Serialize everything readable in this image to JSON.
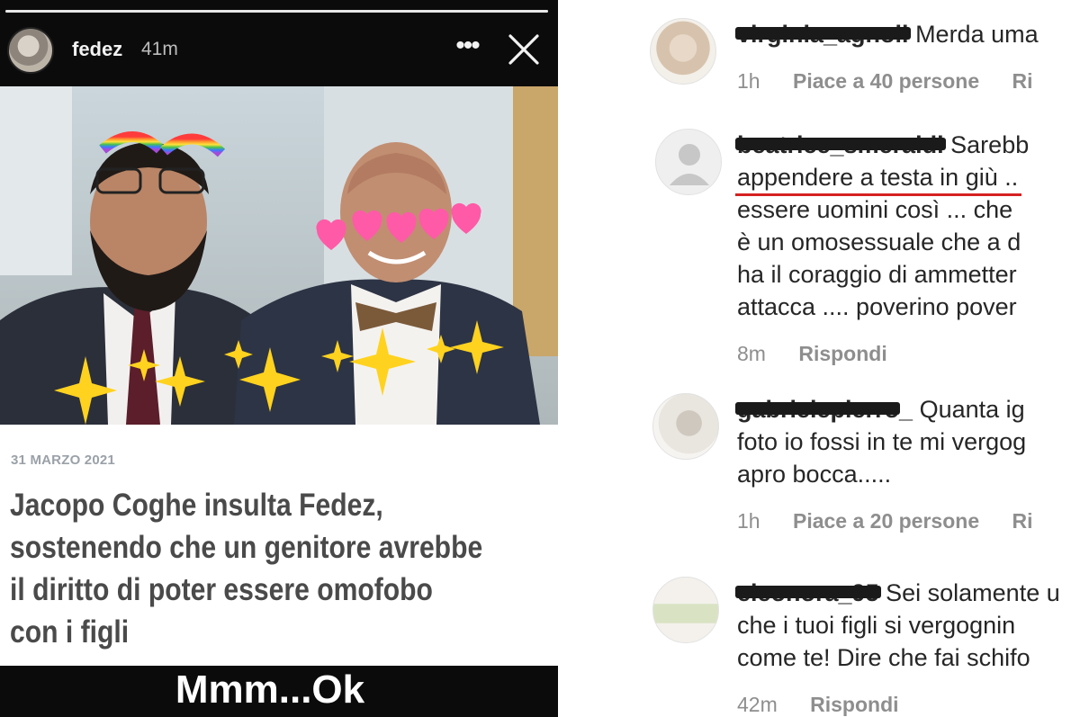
{
  "story": {
    "username": "fedez",
    "time": "41m",
    "more_icon": "•••",
    "progress": 1.0,
    "article": {
      "date": "31 MARZO 2021",
      "headline_lines": [
        "Jacopo Coghe insulta Fedez,",
        "sostenendo che un genitore avrebbe",
        "il diritto di poter essere omofobo",
        "con i figli"
      ]
    },
    "caption": "Mmm...Ok"
  },
  "comments": [
    {
      "username": "virginia_agnoli",
      "text_lines": [
        "Merda uma"
      ],
      "meta": {
        "time": "1h",
        "likes": "Piace a 40 persone",
        "reply": "Ri"
      }
    },
    {
      "username": "beatrice_smeraldi",
      "text_lines": [
        "Sarebb",
        "appendere a testa in giù ..",
        "essere uomini così ... che",
        "è un omosessuale che a d",
        "ha il coraggio di ammetter",
        "attacca .... poverino pover"
      ],
      "highlight": "appendere a testa in giù",
      "meta": {
        "time": "8m",
        "reply": "Rispondi"
      }
    },
    {
      "username": "gabrielepierro_",
      "text_lines": [
        "Quanta ig",
        "foto io fossi in te mi vergog",
        "apro bocca....."
      ],
      "meta": {
        "time": "1h",
        "likes": "Piace a 20 persone",
        "reply": "Ri"
      }
    },
    {
      "username": "eleonora_95",
      "text_lines": [
        "Sei solamente u",
        "che i tuoi figli si vergognin",
        "come te! Dire che fai schifo"
      ],
      "meta": {
        "time": "42m",
        "reply": "Rispondi"
      }
    }
  ],
  "colors": {
    "story_bg": "#0b0b0b",
    "highlight_underline": "#d62121",
    "meta_grey": "#8e8e8e"
  }
}
